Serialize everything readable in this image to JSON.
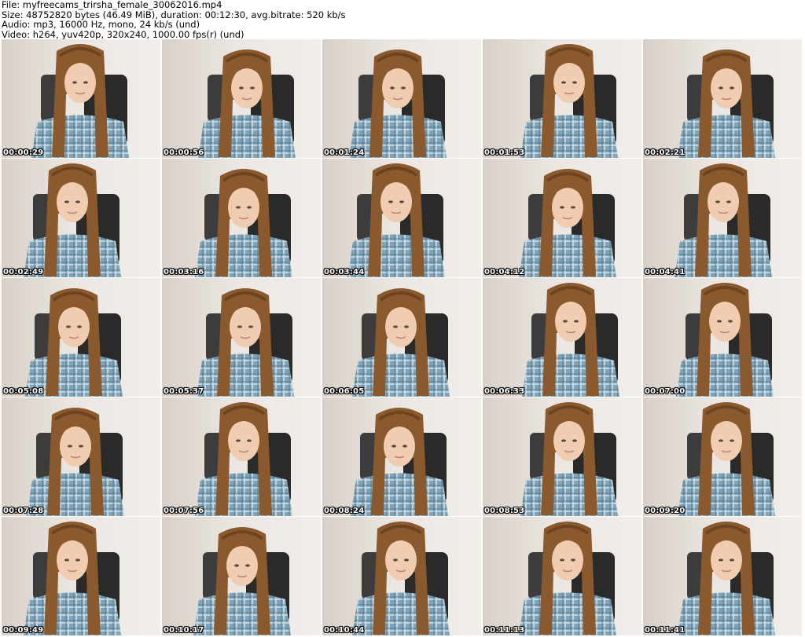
{
  "header": {
    "file": "File: myfreecams_trirsha_female_30062016.mp4",
    "size": "Size: 48752820 bytes (46.49 MiB), duration: 00:12:30, avg.bitrate: 520 kb/s",
    "audio": "Audio: mp3, 16000 Hz, mono, 24 kb/s (und)",
    "video": "Video: h264, yuv420p, 320x240, 1000.00 fps(r) (und)"
  },
  "thumbnails": [
    "00:00:29",
    "00:00:56",
    "00:01:24",
    "00:01:53",
    "00:02:21",
    "00:02:49",
    "00:03:16",
    "00:03:44",
    "00:04:12",
    "00:04:41",
    "00:05:08",
    "00:05:37",
    "00:06:05",
    "00:06:33",
    "00:07:00",
    "00:07:28",
    "00:07:56",
    "00:08:24",
    "00:08:53",
    "00:09:20",
    "00:09:49",
    "00:10:17",
    "00:10:44",
    "00:11:13",
    "00:11:41"
  ],
  "colors": {
    "hair": "#8a5a2e",
    "skin": "#f0cdb0",
    "shirt": "#7fa3b8",
    "chair": "#2a2a2a",
    "wall": "#ebe6e1"
  }
}
